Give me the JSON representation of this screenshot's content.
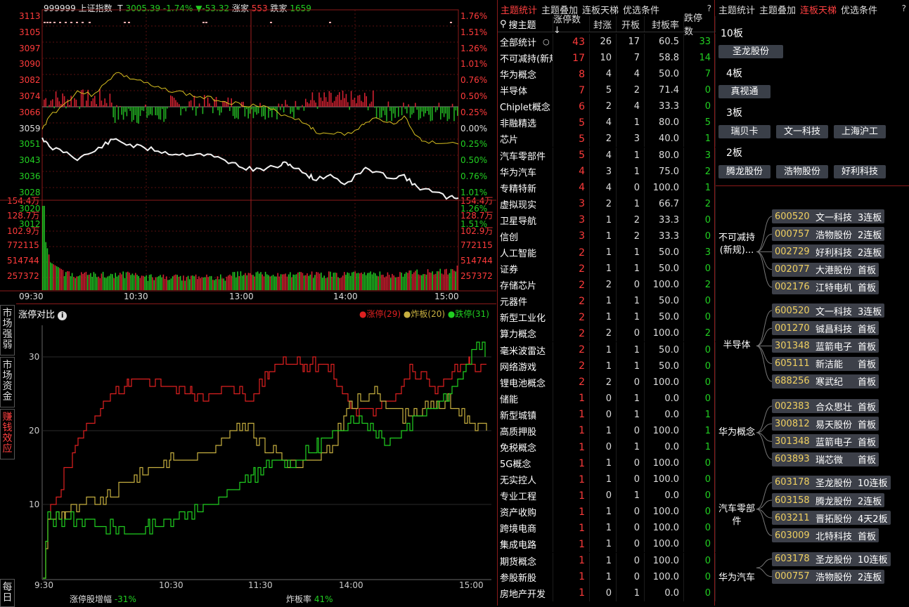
{
  "index": {
    "code": "999999",
    "name": "上证指数",
    "flag": "T",
    "price": "3005.39",
    "pct": "-1.74%",
    "chg": "▼-53.32",
    "up_label": "涨家",
    "up": "553",
    "down_label": "跌家",
    "down": "1659"
  },
  "left_y": [
    "3113",
    "3105",
    "3097",
    "3090",
    "3082",
    "3074",
    "3066",
    "3059",
    "3051",
    "3043",
    "3036",
    "3028",
    "3020",
    "3012"
  ],
  "right_pct": [
    "1.76%",
    "1.51%",
    "1.26%",
    "1.01%",
    "0.76%",
    "0.50%",
    "0.25%",
    "0.00%",
    "0.25%",
    "0.50%",
    "0.76%",
    "1.01%",
    "1.26%",
    "1.51%"
  ],
  "vol_labels": [
    "154.4万",
    "128.7万",
    "102.9万",
    "772115",
    "514744",
    "257372"
  ],
  "time_labels": [
    "09:30",
    "10:30",
    "13:00",
    "14:00",
    "15:00"
  ],
  "compare": {
    "title": "涨停对比",
    "legend": [
      {
        "label": "涨停(29)",
        "color": "#e02020"
      },
      {
        "label": "炸板(20)",
        "color": "#c8b040"
      },
      {
        "label": "跌停(31)",
        "color": "#20d020"
      }
    ],
    "yticks": [
      "30",
      "20",
      "10"
    ],
    "xticks": [
      "9:30",
      "10:30",
      "11:30",
      "14:00",
      "15:00"
    ],
    "foot_left_label": "涨停股增幅",
    "foot_left_val": "-31%",
    "foot_right_label": "炸板率",
    "foot_right_val": "41%"
  },
  "side_tabs": [
    "市场强弱",
    "市场资金",
    "赚钱效应",
    "每日"
  ],
  "mid_tabs": [
    "主题统计",
    "主题叠加",
    "连板天梯",
    "优选条件"
  ],
  "table_headers": [
    "搜主题",
    "涨停数↓",
    "封涨",
    "开板",
    "封板率",
    "跌停数"
  ],
  "table_rows": [
    [
      "全部统计",
      "43",
      "26",
      "17",
      "60.5",
      "33"
    ],
    [
      "不可减持(新规)",
      "17",
      "10",
      "7",
      "58.8",
      "14"
    ],
    [
      "华为概念",
      "8",
      "4",
      "4",
      "50.0",
      "7"
    ],
    [
      "半导体",
      "7",
      "5",
      "2",
      "71.4",
      "0"
    ],
    [
      "Chiplet概念",
      "6",
      "2",
      "4",
      "33.3",
      "0"
    ],
    [
      "非融精选",
      "5",
      "4",
      "1",
      "80.0",
      "5"
    ],
    [
      "芯片",
      "5",
      "2",
      "3",
      "40.0",
      "1"
    ],
    [
      "汽车零部件",
      "5",
      "4",
      "1",
      "80.0",
      "3"
    ],
    [
      "华为汽车",
      "4",
      "3",
      "1",
      "75.0",
      "2"
    ],
    [
      "专精特新",
      "4",
      "4",
      "0",
      "100.0",
      "1"
    ],
    [
      "虚拟现实",
      "3",
      "2",
      "1",
      "66.7",
      "2"
    ],
    [
      "卫星导航",
      "3",
      "1",
      "2",
      "33.3",
      "0"
    ],
    [
      "信创",
      "3",
      "1",
      "2",
      "33.3",
      "0"
    ],
    [
      "人工智能",
      "2",
      "1",
      "1",
      "50.0",
      "3"
    ],
    [
      "证券",
      "2",
      "1",
      "1",
      "50.0",
      "0"
    ],
    [
      "存储芯片",
      "2",
      "2",
      "0",
      "100.0",
      "2"
    ],
    [
      "元器件",
      "2",
      "1",
      "1",
      "50.0",
      "0"
    ],
    [
      "新型工业化",
      "2",
      "1",
      "1",
      "50.0",
      "0"
    ],
    [
      "算力概念",
      "2",
      "2",
      "0",
      "100.0",
      "2"
    ],
    [
      "毫米波雷达",
      "2",
      "1",
      "1",
      "50.0",
      "0"
    ],
    [
      "网络游戏",
      "2",
      "1",
      "1",
      "50.0",
      "0"
    ],
    [
      "锂电池概念",
      "2",
      "2",
      "0",
      "100.0",
      "0"
    ],
    [
      "储能",
      "1",
      "0",
      "1",
      "0.0",
      "0"
    ],
    [
      "新型城镇",
      "1",
      "0",
      "1",
      "0.0",
      "1"
    ],
    [
      "高质押股",
      "1",
      "1",
      "0",
      "100.0",
      "1"
    ],
    [
      "免税概念",
      "1",
      "0",
      "1",
      "0.0",
      "1"
    ],
    [
      "5G概念",
      "1",
      "1",
      "0",
      "100.0",
      "0"
    ],
    [
      "无实控人",
      "1",
      "1",
      "0",
      "100.0",
      "0"
    ],
    [
      "专业工程",
      "1",
      "0",
      "1",
      "0.0",
      "0"
    ],
    [
      "资产收购",
      "1",
      "1",
      "0",
      "100.0",
      "0"
    ],
    [
      "跨境电商",
      "1",
      "1",
      "0",
      "100.0",
      "0"
    ],
    [
      "集成电路",
      "1",
      "1",
      "0",
      "100.0",
      "0"
    ],
    [
      "期货概念",
      "1",
      "1",
      "0",
      "100.0",
      "0"
    ],
    [
      "参股新股",
      "1",
      "1",
      "0",
      "100.0",
      "0"
    ],
    [
      "房地产开发",
      "1",
      "0",
      "1",
      "0.0",
      "0"
    ]
  ],
  "right_tabs": [
    "主题统计",
    "主题叠加",
    "连板天梯",
    "优选条件"
  ],
  "ladder": {
    "b10": "10板",
    "b10s": [
      "圣龙股份"
    ],
    "b4": "4板",
    "b4s": [
      "真视通"
    ],
    "b3": "3板",
    "b3s": [
      "瑞贝卡",
      "文一科技",
      "上海沪工"
    ],
    "b2": "2板",
    "b2s": [
      "腾龙股份",
      "浩物股份",
      "好利科技"
    ]
  },
  "groups": [
    {
      "name": "不可减持(新规)...",
      "stocks": [
        [
          "600520",
          "文一科技",
          "3连板"
        ],
        [
          "000757",
          "浩物股份",
          "2连板"
        ],
        [
          "002729",
          "好利科技",
          "2连板"
        ],
        [
          "002077",
          "大港股份",
          "首板"
        ],
        [
          "002176",
          "江特电机",
          "首板"
        ]
      ]
    },
    {
      "name": "半导体",
      "stocks": [
        [
          "600520",
          "文一科技",
          "3连板"
        ],
        [
          "001270",
          "铖昌科技",
          "首板"
        ],
        [
          "301348",
          "蓝箭电子",
          "首板"
        ],
        [
          "605111",
          "新洁能",
          "首板"
        ],
        [
          "688256",
          "寒武纪",
          "首板"
        ]
      ]
    },
    {
      "name": "华为概念",
      "stocks": [
        [
          "002383",
          "合众思壮",
          "首板"
        ],
        [
          "300812",
          "易天股份",
          "首板"
        ],
        [
          "301348",
          "蓝箭电子",
          "首板"
        ],
        [
          "603893",
          "瑞芯微",
          "首板"
        ]
      ]
    },
    {
      "name": "汽车零部件",
      "stocks": [
        [
          "603178",
          "圣龙股份",
          "10连板"
        ],
        [
          "603158",
          "腾龙股份",
          "2连板"
        ],
        [
          "603211",
          "晋拓股份",
          "4天2板"
        ],
        [
          "603009",
          "北特科技",
          "首板"
        ]
      ]
    },
    {
      "name": "华为汽车",
      "stocks": [
        [
          "603178",
          "圣龙股份",
          "10连板"
        ],
        [
          "000757",
          "浩物股份",
          "2连板"
        ]
      ]
    }
  ]
}
